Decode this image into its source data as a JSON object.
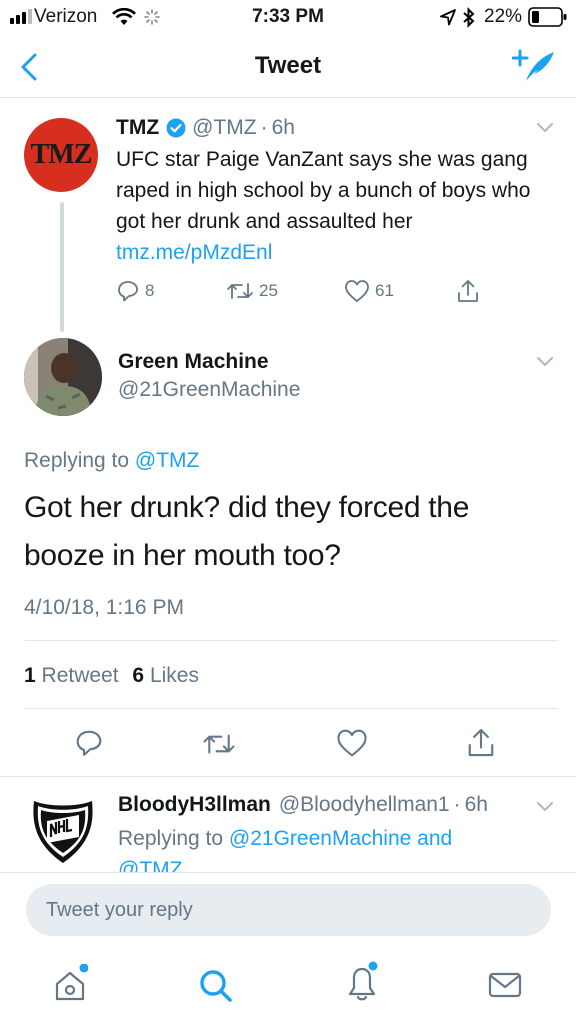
{
  "status_bar": {
    "carrier": "Verizon",
    "time": "7:33 PM",
    "battery": "22%"
  },
  "nav": {
    "title": "Tweet",
    "back_icon": "chevron-left-icon",
    "compose_icon": "compose-tweet-icon"
  },
  "parent_tweet": {
    "avatar_text": "TMZ",
    "name": "TMZ",
    "verified": true,
    "handle": "@TMZ",
    "time": "6h",
    "text": "UFC star Paige VanZant says she was gang raped in high school by a bunch of boys who got her drunk and assaulted her",
    "link": "tmz.me/pMzdEnl",
    "replies": "8",
    "retweets": "25",
    "likes": "61"
  },
  "main_tweet": {
    "name": "Green Machine",
    "handle": "@21GreenMachine",
    "replying_label": "Replying to",
    "replying_to": "@TMZ",
    "text_line1": "Got her drunk? did they forced the",
    "text_line2": "booze in her mouth too?",
    "timestamp": "4/10/18, 1:16 PM",
    "retweet_count": "1",
    "retweet_label": "Retweet",
    "like_count": "6",
    "like_label": "Likes"
  },
  "reply_tweet": {
    "name": "BloodyH3llman",
    "handle": "@Bloodyhellman1",
    "time": "6h",
    "replying_label": "Replying to",
    "replying_to": "@21GreenMachine and",
    "replying_to_cont": "@TMZ"
  },
  "composer": {
    "placeholder": "Tweet your reply"
  },
  "tabs": [
    "home-icon",
    "search-icon",
    "notifications-icon",
    "messages-icon"
  ],
  "colors": {
    "accent": "#1da1f2",
    "muted": "#657786",
    "tmz_red": "#d62e1f"
  }
}
